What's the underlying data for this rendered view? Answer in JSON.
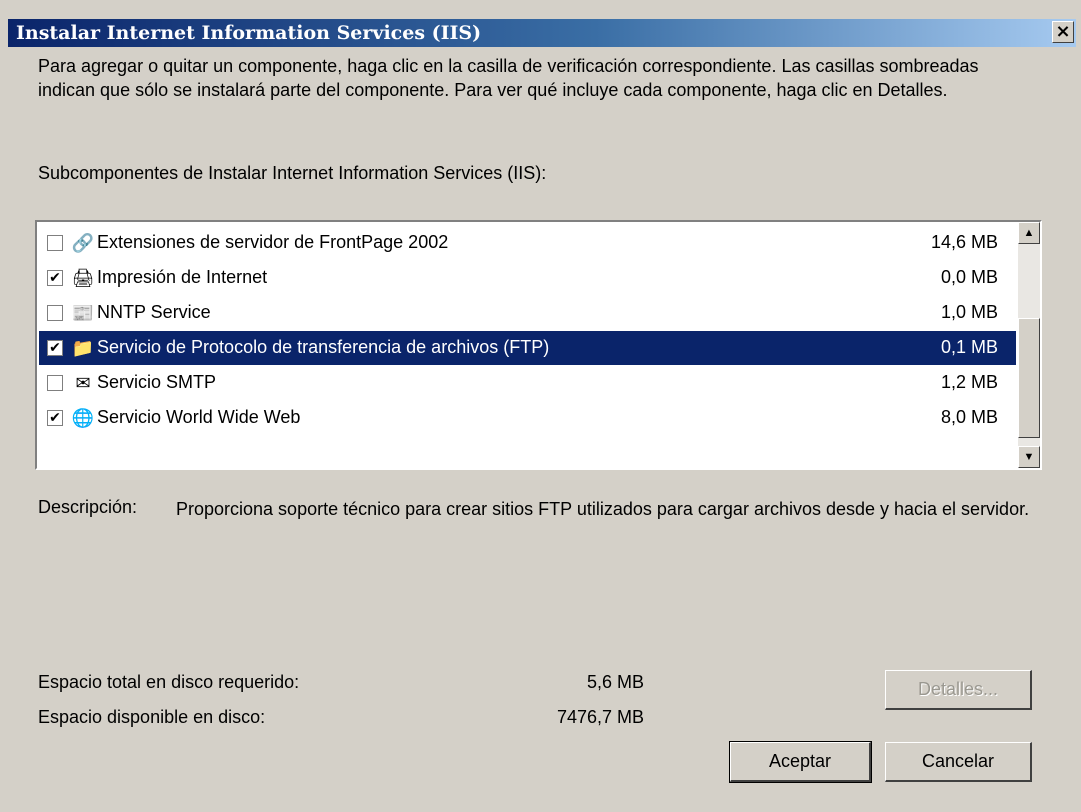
{
  "window": {
    "title": "Instalar Internet Information Services (IIS)"
  },
  "intro_text": "Para agregar o quitar un componente, haga clic en la casilla de verificación correspondiente. Las casillas sombreadas indican que sólo se instalará parte del componente. Para ver qué incluye cada componente, haga clic en Detalles.",
  "subcomponents_label": "Subcomponentes de Instalar Internet Information Services (IIS):",
  "components": [
    {
      "name": "Extensiones de servidor de FrontPage 2002",
      "size": "14,6 MB",
      "checked": false,
      "icon": "frontpage-extensions-icon",
      "selected": false
    },
    {
      "name": "Impresión de Internet",
      "size": "0,0 MB",
      "checked": true,
      "icon": "printer-icon",
      "selected": false
    },
    {
      "name": "NNTP Service",
      "size": "1,0 MB",
      "checked": false,
      "icon": "nntp-icon",
      "selected": false
    },
    {
      "name": "Servicio de Protocolo de transferencia de archivos (FTP)",
      "size": "0,1 MB",
      "checked": true,
      "icon": "folder-icon",
      "selected": true
    },
    {
      "name": "Servicio SMTP",
      "size": "1,2 MB",
      "checked": false,
      "icon": "mail-icon",
      "selected": false
    },
    {
      "name": "Servicio World Wide Web",
      "size": "8,0 MB",
      "checked": true,
      "icon": "globe-icon",
      "selected": false
    }
  ],
  "description": {
    "label": "Descripción:",
    "text": "Proporciona soporte técnico para crear sitios FTP utilizados para cargar archivos desde y hacia el servidor."
  },
  "disk": {
    "required_label": "Espacio total en disco requerido:",
    "required_value": "5,6 MB",
    "available_label": "Espacio disponible en disco:",
    "available_value": "7476,7 MB"
  },
  "buttons": {
    "details": "Detalles...",
    "accept": "Aceptar",
    "cancel": "Cancelar"
  },
  "icons": {
    "close": "close-icon",
    "scroll_up": "scroll-up-icon",
    "scroll_down": "scroll-down-icon"
  }
}
